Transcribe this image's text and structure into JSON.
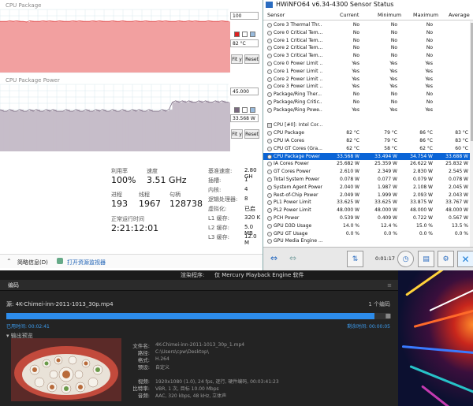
{
  "graphs": {
    "top": {
      "title": "CPU Package",
      "max_label": "100",
      "readout": "82 °C",
      "fit_label": "Fit y",
      "reset_label": "Reset",
      "fill": "#f2a0a0",
      "line": "#e04040"
    },
    "bottom": {
      "title": "CPU Package Power",
      "max_label": "45.000",
      "readout": "33.568 W",
      "fit_label": "Fit y",
      "reset_label": "Reset",
      "fill": "#c6bdc9",
      "line": "#7a6a80"
    }
  },
  "taskmgr": {
    "util_label": "利用率",
    "util_value": "100%",
    "speed_label": "速度",
    "speed_value": "3.51 GHz",
    "proc_label": "进程",
    "proc_value": "193",
    "thread_label": "线程",
    "thread_value": "1967",
    "handle_label": "句柄",
    "handle_value": "128738",
    "uptime_label": "正常运行时间",
    "uptime_value": "2:21:12:01",
    "right": [
      {
        "label": "基准速度:",
        "value": "2.80 GH"
      },
      {
        "label": "插槽:",
        "value": "1"
      },
      {
        "label": "内核:",
        "value": "4"
      },
      {
        "label": "逻辑处理器:",
        "value": "8"
      },
      {
        "label": "虚拟化:",
        "value": "已启"
      },
      {
        "label": "L1 缓存:",
        "value": "320 K"
      },
      {
        "label": "L2 缓存:",
        "value": "5.0 MB"
      },
      {
        "label": "L3 缓存:",
        "value": "12.0 M"
      }
    ],
    "brief_label": "简略信息(D)",
    "monitor_label": "打开资源监视器"
  },
  "hwinfo": {
    "title": "HWiNFO64 v6.34-4300 Sensor Status",
    "columns": [
      "Sensor",
      "Current",
      "Minimum",
      "Maximum",
      "Average"
    ],
    "elapsed": "0:01:17",
    "rows": [
      {
        "n": "Core 3 Thermal Thr...",
        "c": "No",
        "mi": "No",
        "ma": "No",
        "a": ""
      },
      {
        "n": "Core 0 Critical Tem...",
        "c": "No",
        "mi": "No",
        "ma": "No",
        "a": ""
      },
      {
        "n": "Core 1 Critical Tem...",
        "c": "No",
        "mi": "No",
        "ma": "No",
        "a": ""
      },
      {
        "n": "Core 2 Critical Tem...",
        "c": "No",
        "mi": "No",
        "ma": "No",
        "a": ""
      },
      {
        "n": "Core 3 Critical Tem...",
        "c": "No",
        "mi": "No",
        "ma": "No",
        "a": ""
      },
      {
        "n": "Core 0 Power Limit ...",
        "c": "Yes",
        "mi": "Yes",
        "ma": "Yes",
        "a": ""
      },
      {
        "n": "Core 1 Power Limit ...",
        "c": "Yes",
        "mi": "Yes",
        "ma": "Yes",
        "a": ""
      },
      {
        "n": "Core 2 Power Limit ...",
        "c": "Yes",
        "mi": "Yes",
        "ma": "Yes",
        "a": ""
      },
      {
        "n": "Core 3 Power Limit ...",
        "c": "Yes",
        "mi": "Yes",
        "ma": "Yes",
        "a": ""
      },
      {
        "n": "Package/Ring Ther...",
        "c": "No",
        "mi": "No",
        "ma": "No",
        "a": ""
      },
      {
        "n": "Package/Ring Critic...",
        "c": "No",
        "mi": "No",
        "ma": "No",
        "a": ""
      },
      {
        "n": "Package/Ring Powe...",
        "c": "Yes",
        "mi": "Yes",
        "ma": "Yes",
        "a": ""
      },
      {
        "gap": true
      },
      {
        "grp": true,
        "n": "CPU [#0]: Intel Cor..."
      },
      {
        "n": "CPU Package",
        "c": "82 °C",
        "mi": "79 °C",
        "ma": "86 °C",
        "a": "83 °C"
      },
      {
        "n": "CPU IA Cores",
        "c": "82 °C",
        "mi": "79 °C",
        "ma": "86 °C",
        "a": "83 °C"
      },
      {
        "n": "CPU GT Cores (Gra...",
        "c": "62 °C",
        "mi": "58 °C",
        "ma": "62 °C",
        "a": "60 °C"
      },
      {
        "n": "CPU Package Power",
        "c": "33.568 W",
        "mi": "33.494 W",
        "ma": "34.754 W",
        "a": "33.688 W",
        "sel": true
      },
      {
        "n": "IA Cores Power",
        "c": "25.682 W",
        "mi": "25.359 W",
        "ma": "26.622 W",
        "a": "25.832 W"
      },
      {
        "n": "GT Cores Power",
        "c": "2.610 W",
        "mi": "2.349 W",
        "ma": "2.830 W",
        "a": "2.545 W"
      },
      {
        "n": "Total System Power",
        "c": "0.078 W",
        "mi": "0.077 W",
        "ma": "0.079 W",
        "a": "0.078 W"
      },
      {
        "n": "System Agent Power",
        "c": "2.040 W",
        "mi": "1.987 W",
        "ma": "2.108 W",
        "a": "2.045 W"
      },
      {
        "n": "Rest-of-Chip Power",
        "c": "2.049 W",
        "mi": "1.999 W",
        "ma": "2.093 W",
        "a": "2.043 W"
      },
      {
        "n": "PL1 Power Limit",
        "c": "33.625 W",
        "mi": "33.625 W",
        "ma": "33.875 W",
        "a": "33.767 W"
      },
      {
        "n": "PL2 Power Limit",
        "c": "48.000 W",
        "mi": "48.000 W",
        "ma": "48.000 W",
        "a": "48.000 W"
      },
      {
        "n": "PCH Power",
        "c": "0.539 W",
        "mi": "0.409 W",
        "ma": "0.722 W",
        "a": "0.567 W"
      },
      {
        "n": "GPU D3D Usage",
        "c": "14.0 %",
        "mi": "12.4 %",
        "ma": "15.0 %",
        "a": "13.5 %"
      },
      {
        "n": "GPU GT Usage",
        "c": "0.0 %",
        "mi": "0.0 %",
        "ma": "0.0 %",
        "a": "0.0 %"
      },
      {
        "n": "GPU Media Engine ...",
        "c": "",
        "mi": "",
        "ma": "",
        "a": ""
      }
    ]
  },
  "encoder": {
    "renderer_label": "渲染程序:",
    "renderer_value": "仅 Mercury Playback Engine 软件",
    "tab_label": "编码",
    "source_label": "源:",
    "source_name": "4K-Chimei-inn-2011-1013_30p.mp4",
    "queue_count": "1 个编码",
    "progress": 0.96,
    "elapsed_label": "已用时间: 00:02:41",
    "remaining_label": "剩余时间: 00:00:05",
    "output_label": "输出预览",
    "kv": [
      {
        "k": "文件名:",
        "v": "4K-Chimei-inn-2011-1013_30p_1.mp4"
      },
      {
        "k": "路径:",
        "v": "C:\\Users\\cpw\\Desktop\\"
      },
      {
        "k": "格式:",
        "v": "H.264"
      },
      {
        "k": "预设:",
        "v": "自定义"
      },
      {
        "k": "视频:",
        "v": "1920x1080 (1.0), 24 fps, 逐行, 硬件编码, 00:03:41:23"
      },
      {
        "k": "比特率:",
        "v": "VBR, 1 次, 目标 10.00 Mbps"
      },
      {
        "k": "音频:",
        "v": "AAC, 320 kbps, 48 kHz, 立体声"
      }
    ]
  },
  "chart_data": [
    {
      "type": "area",
      "title": "CPU Package",
      "ylim": [
        0,
        100
      ],
      "series": [
        {
          "name": "CPU Package",
          "values": [
            81,
            81,
            81,
            82,
            81,
            82,
            81,
            81,
            80,
            82,
            81,
            81,
            81,
            82,
            81,
            82,
            81,
            81,
            82,
            81,
            81,
            81,
            82,
            81,
            82,
            81,
            81,
            81,
            82,
            81,
            82,
            81,
            81,
            81,
            82,
            81,
            81,
            82,
            81,
            81,
            81,
            82,
            81,
            81,
            82,
            81,
            81,
            81,
            82,
            81,
            82,
            81,
            81,
            81,
            82,
            81,
            81,
            82,
            81,
            82,
            81,
            81,
            81,
            82,
            81,
            81,
            81,
            82,
            81,
            81
          ]
        }
      ]
    },
    {
      "type": "area",
      "title": "CPU Package Power",
      "ylim": [
        0,
        45
      ],
      "series": [
        {
          "name": "CPU Package Power",
          "values": [
            28,
            27,
            27,
            28,
            27,
            27,
            28,
            27,
            27,
            28,
            27,
            28,
            27,
            27,
            28,
            27,
            28,
            27,
            27,
            27,
            28,
            27,
            27,
            28,
            27,
            27,
            28,
            27,
            27,
            28,
            27,
            28,
            27,
            27,
            28,
            27,
            27,
            28,
            27,
            27,
            28,
            27,
            28,
            27,
            27,
            28,
            27,
            27,
            27,
            28,
            27,
            28,
            33,
            34,
            33,
            34,
            33,
            34,
            33,
            33,
            34,
            33,
            34,
            33,
            33,
            34,
            33,
            34,
            33,
            33
          ]
        }
      ]
    }
  ]
}
